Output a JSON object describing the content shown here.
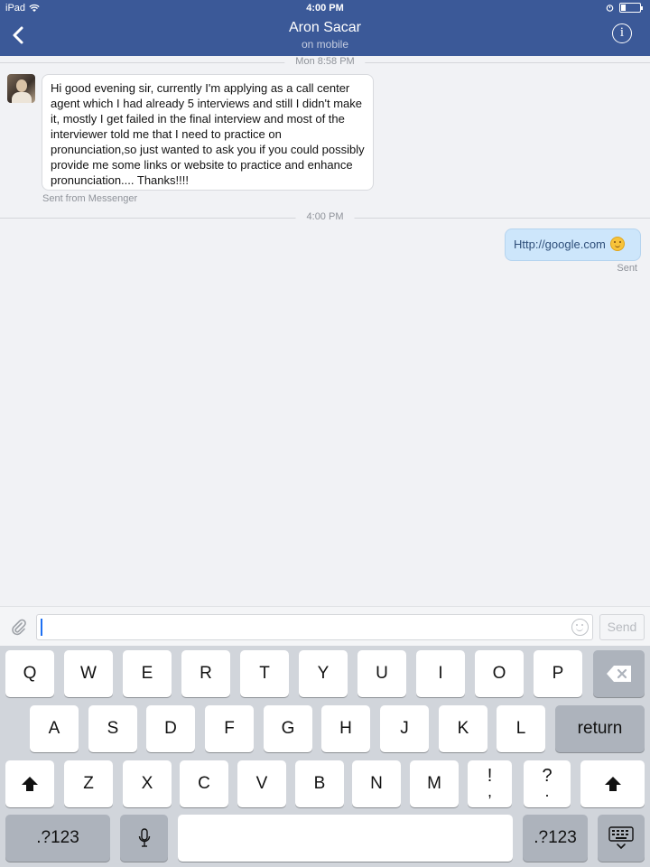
{
  "status_bar": {
    "device": "iPad",
    "time": "4:00 PM"
  },
  "header": {
    "title": "Aron Sacar",
    "subtitle": "on mobile"
  },
  "messages": {
    "first_time": "Mon 8:58 PM",
    "incoming_text": "Hi good evening sir, currently I'm applying as a call center agent which I had already 5 interviews and still I didn't make it, mostly I get failed in the final interview and most of the interviewer told me that I need to practice on pronunciation,so just wanted to ask you if you could possibly provide me some links or website to practice and enhance pronunciation.... Thanks!!!!",
    "incoming_meta": "Sent from Messenger",
    "second_time": "4:00 PM",
    "outgoing_text": "Http://google.com",
    "outgoing_status": "Sent"
  },
  "composer": {
    "value": "",
    "send_label": "Send"
  },
  "keyboard": {
    "row1": [
      "Q",
      "W",
      "E",
      "R",
      "T",
      "Y",
      "U",
      "I",
      "O",
      "P"
    ],
    "row2": [
      "A",
      "S",
      "D",
      "F",
      "G",
      "H",
      "J",
      "K",
      "L"
    ],
    "return_label": "return",
    "row3": [
      "Z",
      "X",
      "C",
      "V",
      "B",
      "N",
      "M"
    ],
    "punct1": [
      "!",
      ","
    ],
    "punct2": [
      "?",
      "."
    ],
    "numbers_label": ".?123"
  },
  "icons": {
    "back": "chevron-left-icon",
    "info": "info-icon",
    "attach": "paperclip-icon",
    "emoji": "smiley-icon",
    "backspace": "backspace-icon",
    "shift": "shift-arrow-icon",
    "mic": "microphone-icon",
    "hide_keyboard": "keyboard-hide-icon",
    "wifi": "wifi-icon",
    "alarm": "alarm-icon",
    "battery": "battery-icon"
  },
  "colors": {
    "header": "#3b5998",
    "outgoing_bubble": "#cde6fb",
    "keyboard_bg": "#d1d5db",
    "caret": "#1d6ff2"
  }
}
